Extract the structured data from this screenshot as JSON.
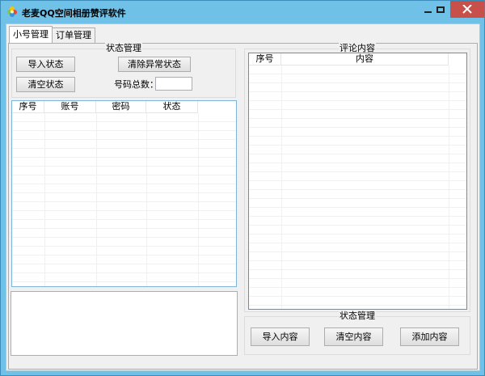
{
  "window": {
    "title": "老麦QQ空间相册赞评软件",
    "title_color": "#000000",
    "chrome_color": "#6fc1e8",
    "close_color": "#c7504a",
    "icon": "app-flower-icon"
  },
  "tabs": [
    {
      "label": "小号管理",
      "active": true
    },
    {
      "label": "订单管理",
      "active": false
    }
  ],
  "account_panel": {
    "group_title": "状态管理",
    "import_status_label": "导入状态",
    "clear_abnormal_label": "清除异常状态",
    "clear_status_label": "清空状态",
    "total_label": "号码总数：",
    "total_value": "",
    "columns": [
      "序号",
      "账号",
      "密码",
      "状态"
    ],
    "rows": []
  },
  "comment_panel": {
    "group_title": "评论内容",
    "columns": [
      "序号",
      "内容"
    ],
    "rows": []
  },
  "comment_actions": {
    "group_title": "状态管理",
    "import_content_label": "导入内容",
    "clear_content_label": "清空内容",
    "add_content_label": "添加内容"
  },
  "log": {
    "value": ""
  }
}
